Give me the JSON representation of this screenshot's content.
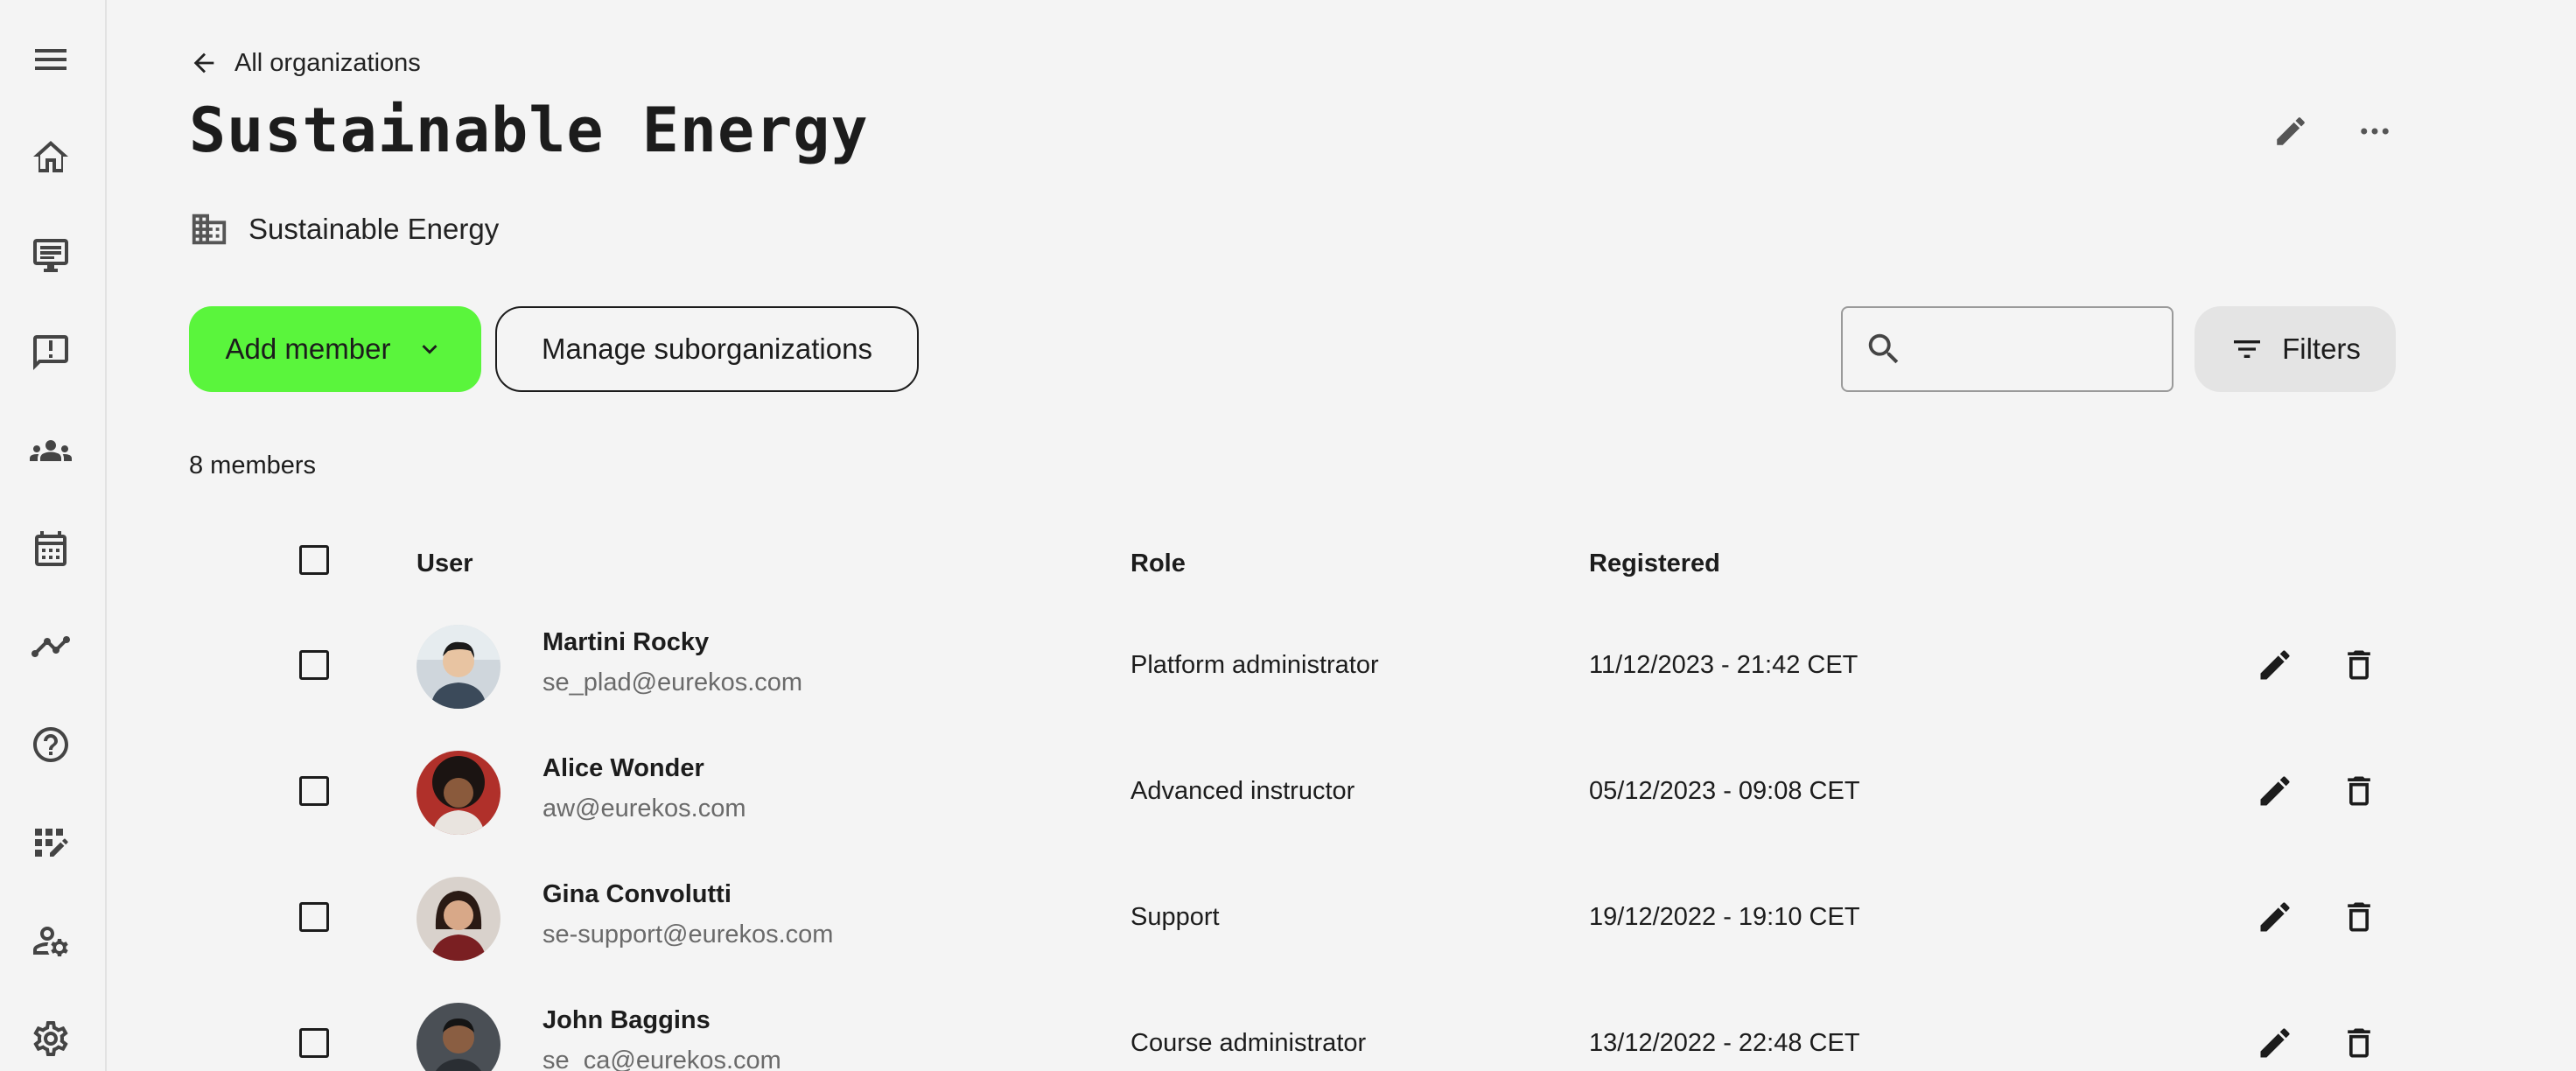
{
  "nav": {
    "back_label": "All organizations"
  },
  "page": {
    "title": "Sustainable Energy",
    "organization_name": "Sustainable Energy"
  },
  "toolbar": {
    "add_member_label": "Add member",
    "manage_suborganizations_label": "Manage suborganizations",
    "search_placeholder": "",
    "search_value": "",
    "filters_label": "Filters"
  },
  "members": {
    "count_label": "8 members",
    "columns": {
      "user": "User",
      "role": "Role",
      "registered": "Registered"
    },
    "rows": [
      {
        "name": "Martini Rocky",
        "email": "se_plad@eurekos.com",
        "role": "Platform administrator",
        "registered": "11/12/2023 - 21:42 CET"
      },
      {
        "name": "Alice Wonder",
        "email": "aw@eurekos.com",
        "role": "Advanced instructor",
        "registered": "05/12/2023 - 09:08 CET"
      },
      {
        "name": "Gina Convolutti",
        "email": "se-support@eurekos.com",
        "role": "Support",
        "registered": "19/12/2022 - 19:10 CET"
      },
      {
        "name": "John Baggins",
        "email": "se_ca@eurekos.com",
        "role": "Course administrator",
        "registered": "13/12/2022 - 22:48 CET"
      }
    ]
  },
  "sidebar": {
    "icons": [
      "menu-icon",
      "home-icon",
      "courses-icon",
      "feedback-icon",
      "groups-icon",
      "calendar-icon",
      "analytics-icon",
      "help-icon",
      "dashboard-edit-icon",
      "user-settings-icon",
      "settings-icon"
    ]
  },
  "colors": {
    "accent": "#5af53c",
    "background": "#f4f4f4",
    "text": "#1c1c1c",
    "muted_text": "#6a6a6a"
  }
}
